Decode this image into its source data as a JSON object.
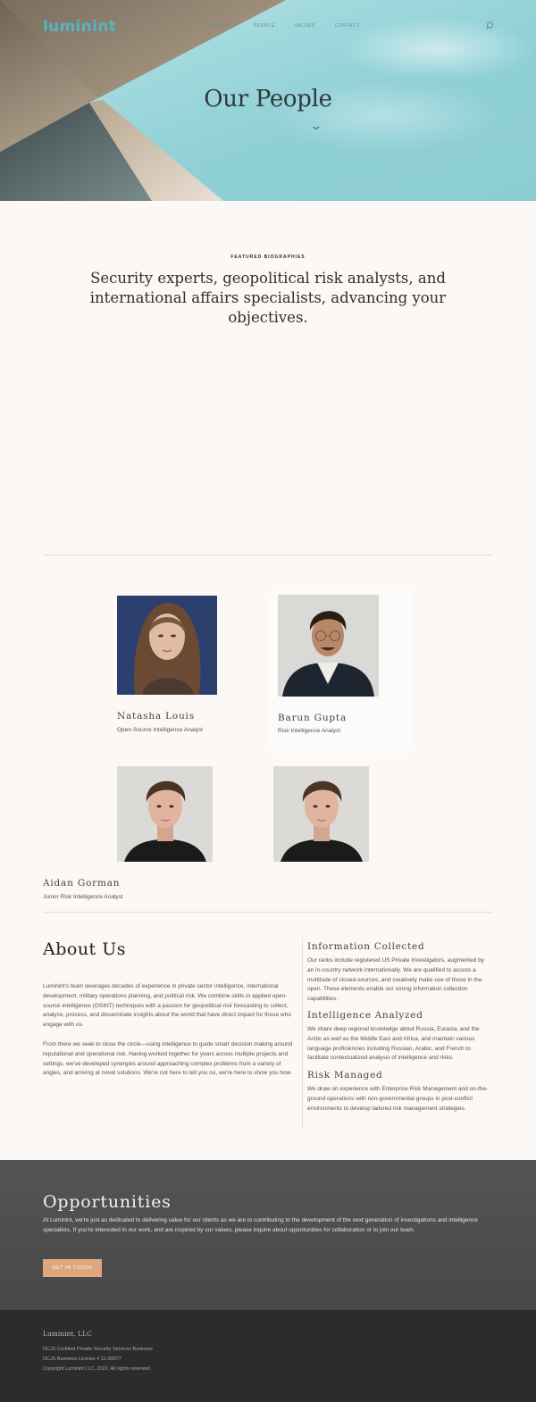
{
  "brand": {
    "logo": "luminint",
    "accent": "#54b4c2"
  },
  "nav": {
    "items": [
      "Services",
      "People",
      "Values",
      "Contact"
    ],
    "search_icon": "search-icon"
  },
  "hero": {
    "title": "Our People",
    "down_icon": "chevron-down-icon"
  },
  "featured": {
    "eyebrow": "FEATURED BIOGRAPHIES",
    "lead": "Security experts, geopolitical risk analysts, and international affairs specialists, advancing your objectives."
  },
  "people": [
    {
      "name": "Natasha Louis",
      "role": "Open-Source Intelligence Analyst"
    },
    {
      "name": "Barun Gupta",
      "role": "Risk Intelligence Analyst"
    },
    {
      "name": "Aidan Gorman",
      "role": "Junior Risk Intelligence Analyst"
    }
  ],
  "about": {
    "title": "About Us",
    "p1": "Luminint's team leverages decades of experience in private sector intelligence, international development, military operations planning, and political risk. We combine skills in applied open-source intelligence (OSINT) techniques with a passion for geopolitical risk forecasting to collect, analyze, process, and disseminate insights about the world that have direct impact for those who engage with us.",
    "p2": "From there we seek to close the circle—using intelligence to guide smart decision making around reputational and operational risk. Having worked together for years across multiple projects and settings, we've developed synergies around approaching complex problems from a variety of angles, and arriving at novel solutions. We're not here to tell you no, we're here to show you how.",
    "sections": [
      {
        "title": "Information Collected",
        "text": "Our ranks include registered US Private Investigators, augmented by an in-country network internationally. We are qualified to access a multitude of closed-sources, and creatively make use of those in the open. These elements enable our strong information collection capabilities."
      },
      {
        "title": "Intelligence Analyzed",
        "text": "We share deep regional knowledge about Russia, Eurasia, and the Arctic as well as the Middle East and Africa, and maintain various language proficiencies including Russian, Arabic, and French to facilitate contextualized analysis of intelligence and risks."
      },
      {
        "title": "Risk Managed",
        "text": "We draw on experience with Enterprise Risk Management and on-the-ground operations with non-governmental groups in post-conflict environments to develop tailored risk management strategies."
      }
    ]
  },
  "opportunities": {
    "title": "Opportunities",
    "text": "At Luminint, we're just as dedicated to delivering value for our clients as we are to contributing to the development of the next generation of investigations and intelligence specialists. If you're interested in our work, and are inspired by our values, please inquire about opportunities for collaboration or to join our team.",
    "button": "Get in touch",
    "button_color": "#e0a77f"
  },
  "footer": {
    "brand": "Luminint, LLC",
    "lines": [
      "DCJS Certified Private Security Services Business",
      "DCJS Business License # 11-20077",
      "Copyright Luminint LLC, 2022.  All rights reserved."
    ]
  }
}
